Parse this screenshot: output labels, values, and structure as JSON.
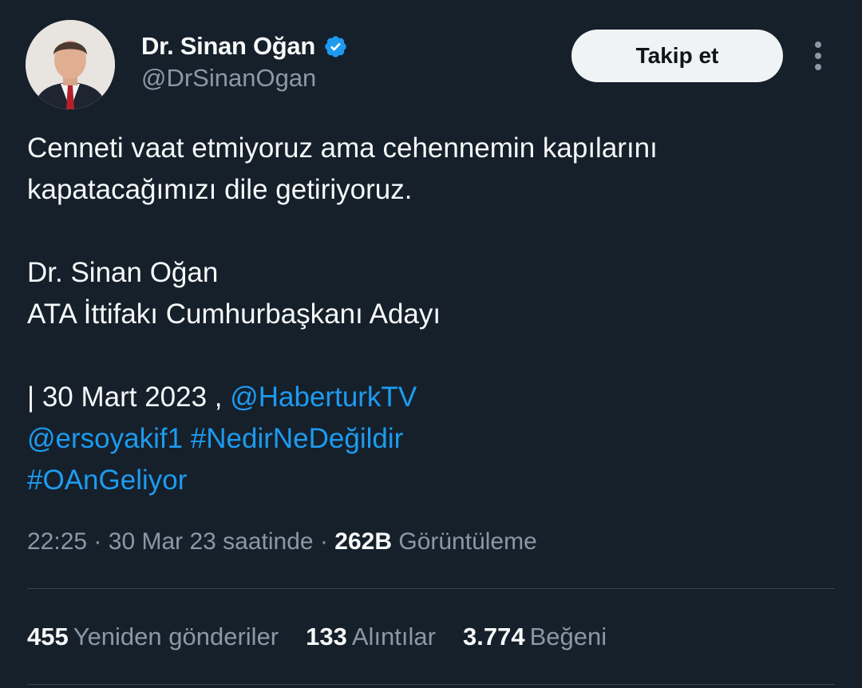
{
  "author": {
    "display_name": "Dr. Sinan Oğan",
    "handle": "@DrSinanOgan",
    "verified_color": "#1d9bf0"
  },
  "follow_button": {
    "label": "Takip et"
  },
  "more_icon": "more-vertical-icon",
  "tweet": {
    "line1": "Cenneti vaat etmiyoruz ama cehennemin kapılarını",
    "line2": "kapatacağımızı dile getiriyoruz.",
    "line3": "Dr. Sinan Oğan",
    "line4": "ATA İttifakı Cumhurbaşkanı Adayı",
    "line5_prefix": "| 30 Mart 2023 , ",
    "mention1": "@HaberturkTV",
    "mention2": "@ersoyakif1",
    "hashtag1": "#NedirNeDeğildir",
    "hashtag2": "#OAnGeliyor"
  },
  "meta": {
    "time": "22:25",
    "date": "30 Mar 23 saatinde",
    "views_count": "262B",
    "views_label": "Görüntüleme"
  },
  "stats": {
    "retweets_count": "455",
    "retweets_label": "Yeniden gönderiler",
    "quotes_count": "133",
    "quotes_label": "Alıntılar",
    "likes_count": "3.774",
    "likes_label": "Beğeni"
  },
  "colors": {
    "background": "#15202b",
    "text": "#f7f9f9",
    "secondary": "#8b98a5",
    "link": "#1d9bf0",
    "divider": "#38444d",
    "button_bg": "#eff3f4"
  }
}
